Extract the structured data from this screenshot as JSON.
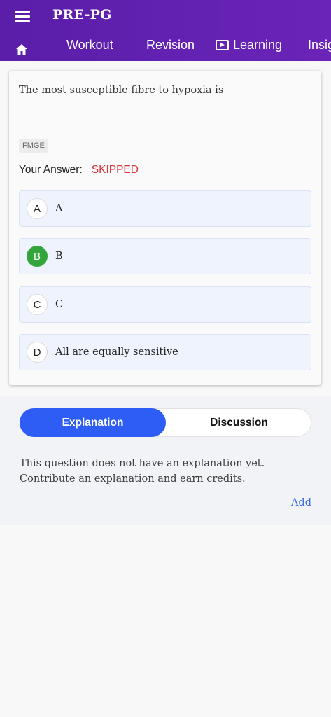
{
  "app": {
    "title": "PRE-PG",
    "icons": {
      "menu": "hamburger-menu-icon",
      "home": "home-icon",
      "learning": "play-tv-icon"
    }
  },
  "nav": {
    "tabs": [
      {
        "label": "Workout"
      },
      {
        "label": "Revision"
      },
      {
        "label": "Learning"
      },
      {
        "label": "Insig"
      }
    ]
  },
  "question": {
    "text": "The most susceptible fibre to hypoxia is",
    "tag": "FMGE",
    "answer_label": "Your Answer:",
    "answer_value": "SKIPPED",
    "options": [
      {
        "letter": "A",
        "text": "A",
        "correct": false
      },
      {
        "letter": "B",
        "text": "B",
        "correct": true
      },
      {
        "letter": "C",
        "text": "C",
        "correct": false
      },
      {
        "letter": "D",
        "text": "All are equally sensitive",
        "correct": false
      }
    ]
  },
  "explanation": {
    "tabs": {
      "explanation": "Explanation",
      "discussion": "Discussion"
    },
    "active_tab": "explanation",
    "message": "This question does not have an explanation yet. Contribute an explanation and earn credits.",
    "add_label": "Add"
  },
  "colors": {
    "appbar": "#5a1ea8",
    "accent": "#2e5df6",
    "correct": "#34a53a",
    "skipped": "#d6323c",
    "link": "#3b6fe8"
  }
}
